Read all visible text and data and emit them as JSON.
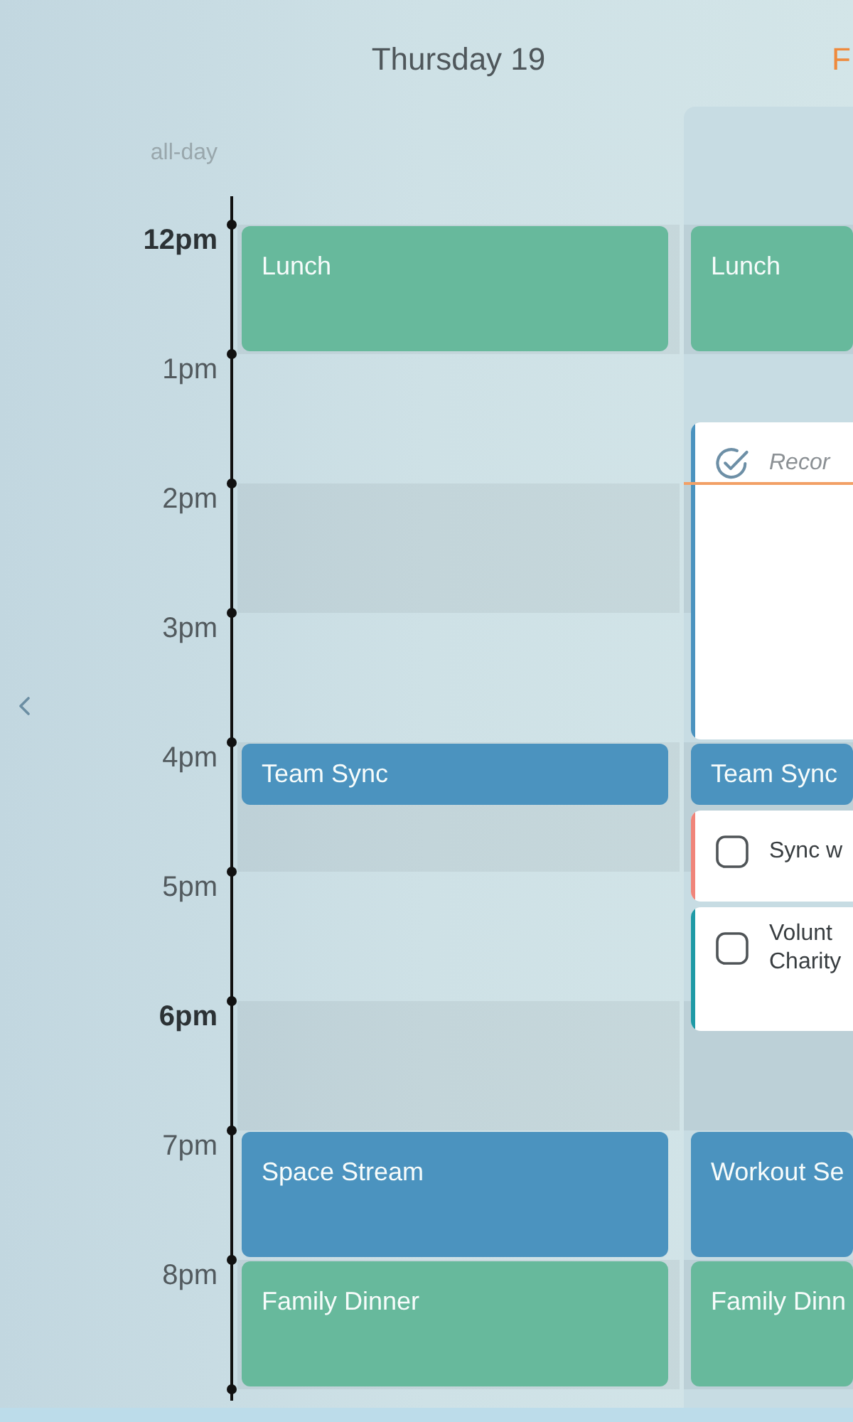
{
  "all_day_label": "all-day",
  "time_labels": [
    {
      "label": "12pm",
      "bold": true
    },
    {
      "label": "1pm",
      "bold": false
    },
    {
      "label": "2pm",
      "bold": false
    },
    {
      "label": "3pm",
      "bold": false
    },
    {
      "label": "4pm",
      "bold": false
    },
    {
      "label": "5pm",
      "bold": false
    },
    {
      "label": "6pm",
      "bold": true
    },
    {
      "label": "7pm",
      "bold": false
    },
    {
      "label": "8pm",
      "bold": false
    }
  ],
  "days": [
    {
      "header": "Thursday 19",
      "today": false,
      "events": [
        {
          "kind": "event",
          "title": "Lunch",
          "color": "#67b99c"
        },
        {
          "kind": "event",
          "title": "Team Sync",
          "color": "#4b93bf"
        },
        {
          "kind": "event",
          "title": "Space Stream",
          "color": "#4b93bf"
        },
        {
          "kind": "event",
          "title": "Family Dinner",
          "color": "#67b99c"
        }
      ]
    },
    {
      "header": "F",
      "today": true,
      "events": [
        {
          "kind": "event",
          "title": "Lunch",
          "color": "#67b99c"
        },
        {
          "kind": "task",
          "title_lines": [
            "Recor"
          ],
          "color": "#4b93bf",
          "done": true
        },
        {
          "kind": "event",
          "title": "Team Sync",
          "color": "#4b93bf"
        },
        {
          "kind": "task",
          "title_lines": [
            "Sync w"
          ],
          "color": "#f0857a",
          "done": false
        },
        {
          "kind": "task",
          "title_lines": [
            "Volunt",
            "Charity"
          ],
          "color": "#1f9aa6",
          "done": false
        },
        {
          "kind": "event",
          "title": "Workout Se",
          "color": "#4b93bf"
        },
        {
          "kind": "event",
          "title": "Family Dinn",
          "color": "#67b99c"
        }
      ]
    }
  ]
}
